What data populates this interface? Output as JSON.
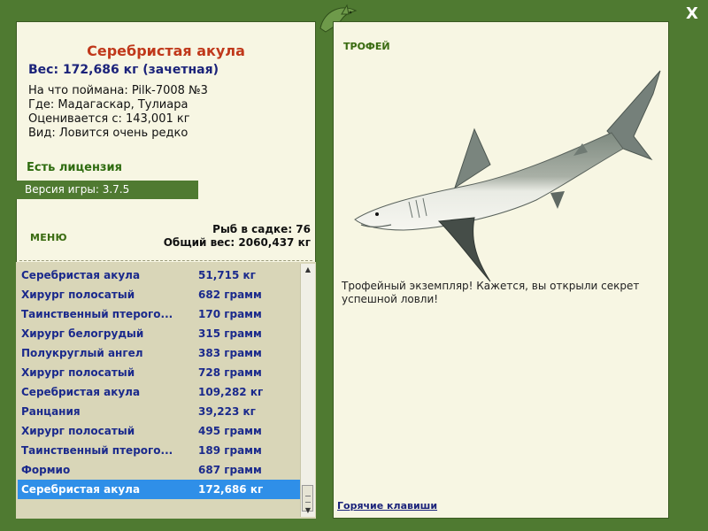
{
  "window": {
    "close_label": "X"
  },
  "fish": {
    "name": "Серебристая акула",
    "weight_line": "Вес: 172,686 кг (зачетная)",
    "caught_on": "На что поймана: Pilk-7008 №3",
    "location": "Где: Мадагаскар, Тулиара",
    "valued_from": "Оценивается с: 143,001 кг",
    "kind": "Вид: Ловится очень редко"
  },
  "license_text": "Есть лицензия",
  "version_text": "Версия игры: 3.7.5",
  "menu_label": "МЕНЮ",
  "stats": {
    "fish_count": "Рыб в садке: 76",
    "total_weight": "Общий вес: 2060,437 кг"
  },
  "catch_list": [
    {
      "name": "Серебристая акула",
      "weight": "51,715 кг"
    },
    {
      "name": "Хирург полосатый",
      "weight": "682 грамм"
    },
    {
      "name": "Таинственный птерого...",
      "weight": "170 грамм"
    },
    {
      "name": "Хирург белогрудый",
      "weight": "315 грамм"
    },
    {
      "name": "Полукруглый ангел",
      "weight": "383 грамм"
    },
    {
      "name": "Хирург полосатый",
      "weight": "728 грамм"
    },
    {
      "name": "Серебристая акула",
      "weight": "109,282 кг"
    },
    {
      "name": "Ранцания",
      "weight": "39,223 кг"
    },
    {
      "name": "Хирург полосатый",
      "weight": "495 грамм"
    },
    {
      "name": "Таинственный птерого...",
      "weight": "189 грамм"
    },
    {
      "name": "Формио",
      "weight": "687 грамм"
    },
    {
      "name": "Серебристая акула",
      "weight": "172,686 кг",
      "selected": true
    }
  ],
  "trophy_label": "ТРОФЕЙ",
  "trophy_description": "Трофейный экземпляр! Кажется, вы открыли секрет успешной ловли!",
  "hotkeys_link": "Горячие клавиши",
  "colors": {
    "frame": "#4f7a31",
    "panel": "#f7f6e3",
    "list_bg": "#d9d6b8",
    "selection": "#2f8fe8",
    "title_red": "#c0381b",
    "text_blue": "#1b2a8c"
  }
}
